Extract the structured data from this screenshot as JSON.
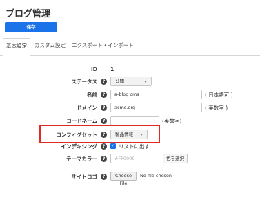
{
  "header": {
    "title": "ブログ管理"
  },
  "toolbar": {
    "save_label": "保存"
  },
  "tabs": [
    {
      "label": "基本設定",
      "active": true
    },
    {
      "label": "カスタム設定",
      "active": false
    },
    {
      "label": "エクスポート・インポート",
      "active": false
    }
  ],
  "form": {
    "id": {
      "label": "ID",
      "value": "1"
    },
    "status": {
      "label": "ステータス",
      "value": "公開"
    },
    "name": {
      "label": "名前",
      "value": "a-blog cms",
      "suffix": "( 日本語可 )"
    },
    "domain": {
      "label": "ドメイン",
      "value": "acms.org",
      "suffix": "( 英数字 )"
    },
    "codename": {
      "label": "コードネーム",
      "value": "",
      "suffix": "(英数字)"
    },
    "config_set": {
      "label": "コンフィグセット",
      "value": "製品情報"
    },
    "indexing": {
      "label": "インデキシング",
      "checkbox_label": "リストに出す",
      "checked": true
    },
    "theme_color": {
      "label": "テーマカラー",
      "placeholder": "#FF0000",
      "button_label": "色を選択"
    },
    "site_logo": {
      "label": "サイトロゴ",
      "button_label": "Choose File",
      "status": "No file chosen"
    }
  },
  "colors": {
    "accent": "#1a73e8",
    "highlight": "#e02b20"
  }
}
